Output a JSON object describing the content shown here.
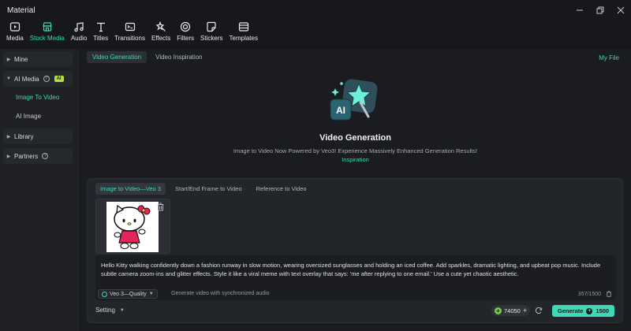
{
  "window": {
    "title": "Material"
  },
  "toolbar": {
    "items": [
      {
        "label": "Media",
        "icon": "media-icon"
      },
      {
        "label": "Stock Media",
        "icon": "stock-media-icon",
        "active": true
      },
      {
        "label": "Audio",
        "icon": "audio-icon"
      },
      {
        "label": "Titles",
        "icon": "titles-icon"
      },
      {
        "label": "Transitions",
        "icon": "transitions-icon"
      },
      {
        "label": "Effects",
        "icon": "effects-icon"
      },
      {
        "label": "Filters",
        "icon": "filters-icon"
      },
      {
        "label": "Stickers",
        "icon": "stickers-icon"
      },
      {
        "label": "Templates",
        "icon": "templates-icon"
      }
    ]
  },
  "sidebar": {
    "mine": "Mine",
    "ai_media": "AI Media",
    "ai_badge": "AI",
    "image_to_video": "Image To Video",
    "ai_image": "AI Image",
    "library": "Library",
    "partners": "Partners"
  },
  "main": {
    "tabs": [
      "Video Generation",
      "Video Inspiration"
    ],
    "my_file": "My File",
    "hero_title": "Video Generation",
    "hero_subtitle": "Image to Video Now Powered by Veo3! Experience Massively Enhanced Generation Results!",
    "hero_link": "Inspiration"
  },
  "panel": {
    "tabs": [
      "Image to Video—Veo 3",
      "Start/End Frame to Video",
      "Reference to Video"
    ],
    "prompt": "Hello Kitty walking confidently down a fashion runway in slow motion, wearing oversized sunglasses and holding an iced coffee. Add sparkles, dramatic lighting, and upbeat pop music. Include subtle camera zoom-ins and glitter effects. Style it like a viral meme with text overlay that says: 'me after replying to one email.' Use a cute yet chaotic aesthetic.",
    "model": "Veo 3—Quality",
    "model_hint": "Generate video with synchronized audio",
    "char_count": "357/1500",
    "setting": "Setting",
    "credits": "74050",
    "generate_label": "Generate",
    "generate_cost": "1500"
  },
  "colors": {
    "accent": "#3fd7b6",
    "badge": "#b6e03a",
    "background": "#16181b"
  }
}
